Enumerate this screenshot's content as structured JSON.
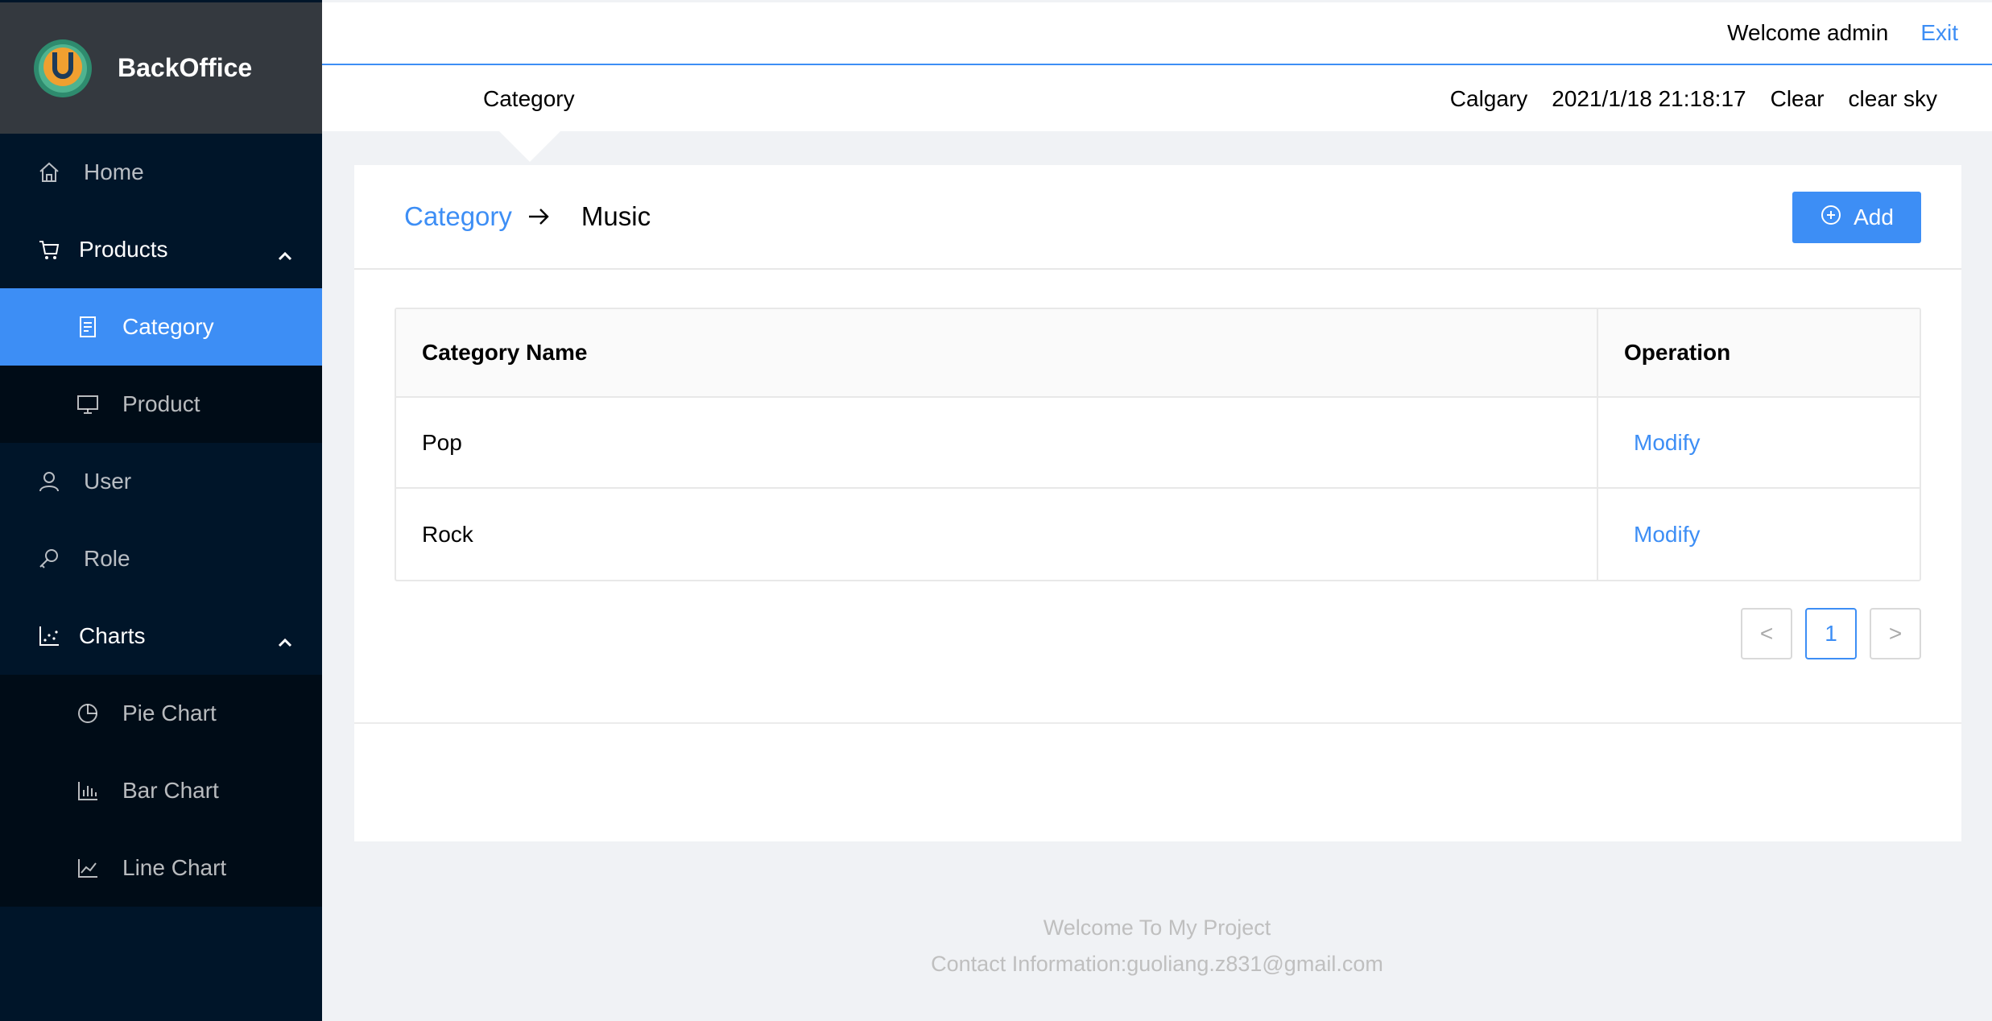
{
  "app": {
    "title": "BackOffice"
  },
  "sidebar": {
    "items": [
      {
        "label": "Home",
        "icon": "home-icon"
      },
      {
        "label": "Products",
        "icon": "cart-icon",
        "open": true,
        "children": [
          {
            "label": "Category",
            "icon": "document-icon",
            "selected": true
          },
          {
            "label": "Product",
            "icon": "monitor-icon"
          }
        ]
      },
      {
        "label": "User",
        "icon": "user-icon"
      },
      {
        "label": "Role",
        "icon": "key-icon"
      },
      {
        "label": "Charts",
        "icon": "chart-icon",
        "open": true,
        "children": [
          {
            "label": "Pie Chart",
            "icon": "pie-chart-icon"
          },
          {
            "label": "Bar Chart",
            "icon": "bar-chart-icon"
          },
          {
            "label": "Line Chart",
            "icon": "line-chart-icon"
          }
        ]
      }
    ]
  },
  "header": {
    "welcome": "Welcome admin",
    "exit": "Exit",
    "page_title": "Category",
    "city": "Calgary",
    "datetime": "2021/1/18 21:18:17",
    "weather": "Clear",
    "weather_desc": "clear sky"
  },
  "card": {
    "breadcrumb_link": "Category",
    "breadcrumb_current": "Music",
    "add_label": "Add",
    "table": {
      "columns": [
        "Category Name",
        "Operation"
      ],
      "rows": [
        {
          "name": "Pop",
          "action": "Modify"
        },
        {
          "name": "Rock",
          "action": "Modify"
        }
      ]
    },
    "pagination": {
      "current": "1",
      "prev": "<",
      "next": ">"
    }
  },
  "footer": {
    "line1": "Welcome To My Project",
    "line2": "Contact Information:guoliang.z831@gmail.com"
  },
  "colors": {
    "accent": "#3d8ef5",
    "sidebar": "#001529",
    "submenu": "#000c17",
    "logo_bar": "#34393f"
  }
}
